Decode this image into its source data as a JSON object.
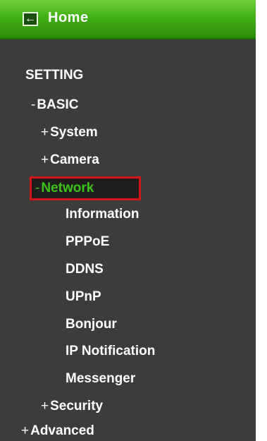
{
  "home": {
    "label": "Home",
    "icon": "back-arrow-icon"
  },
  "menu": {
    "setting": "SETTING",
    "basic": {
      "prefix": "-",
      "label": "BASIC"
    },
    "system": {
      "prefix": "+",
      "label": "System"
    },
    "camera": {
      "prefix": "+",
      "label": "Camera"
    },
    "network": {
      "prefix": "-",
      "label": "Network"
    },
    "network_items": {
      "information": "Information",
      "pppoe": "PPPoE",
      "ddns": "DDNS",
      "upnp": "UPnP",
      "bonjour": "Bonjour",
      "ip_notification": "IP Notification",
      "messenger": "Messenger"
    },
    "security": {
      "prefix": "+",
      "label": "Security"
    },
    "advanced": {
      "prefix": "+",
      "label": "Advanced"
    }
  },
  "colors": {
    "panel_bg": "#3c3c3c",
    "home_bar": "#43b016",
    "active_text": "#3ec21a",
    "highlight_border": "#d4141c"
  }
}
